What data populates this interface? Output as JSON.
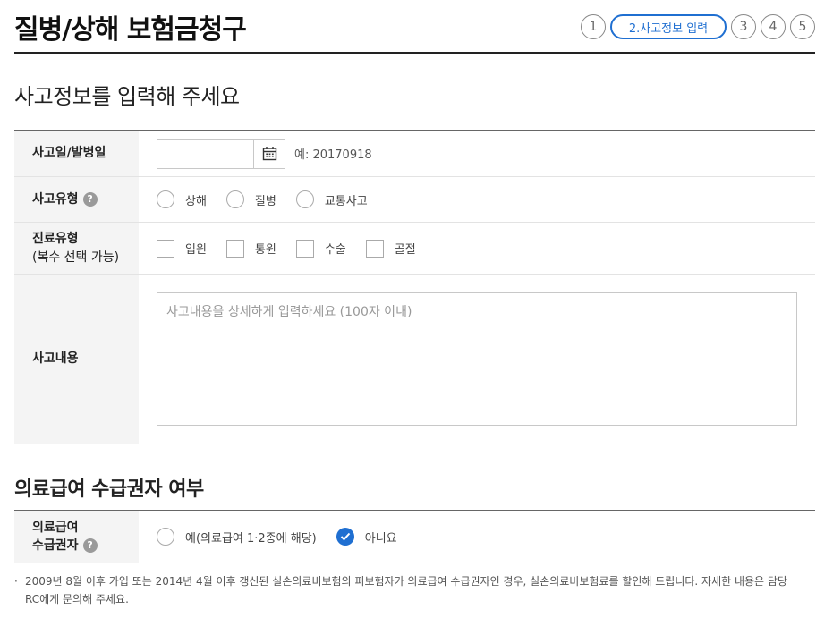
{
  "header": {
    "title": "질병/상해 보험금청구",
    "steps": [
      "1",
      "2.사고정보 입력",
      "3",
      "4",
      "5"
    ],
    "active_step": 1
  },
  "accident_section": {
    "title": "사고정보를 입력해 주세요",
    "date": {
      "label": "사고일/발병일",
      "value": "",
      "hint": "예: 20170918",
      "icon": "calendar-icon"
    },
    "type": {
      "label": "사고유형",
      "options": [
        "상해",
        "질병",
        "교통사고"
      ]
    },
    "treatment": {
      "label": "진료유형",
      "sublabel": "(복수 선택 가능)",
      "options": [
        "입원",
        "통원",
        "수술",
        "골절"
      ]
    },
    "details": {
      "label": "사고내용",
      "placeholder": "사고내용을 상세하게 입력하세요 (100자 이내)",
      "value": ""
    }
  },
  "medical_aid_section": {
    "title": "의료급여 수급권자 여부",
    "label_line1": "의료급여",
    "label_line2": "수급권자",
    "options": [
      "예(의료급여 1·2종에 해당)",
      "아니요"
    ],
    "selected_index": 1
  },
  "help_icon_glyph": "?",
  "note": {
    "bullet": "·",
    "text": "2009년 8월 이후 가입 또는 2014년 4월 이후 갱신된 실손의료비보험의 피보험자가 의료급여 수급권자인 경우, 실손의료비보험료를 할인해 드립니다. 자세한 내용은 담당RC에게 문의해 주세요."
  },
  "colors": {
    "accent": "#1f6fd1",
    "label_bg": "#f4f4f4"
  }
}
